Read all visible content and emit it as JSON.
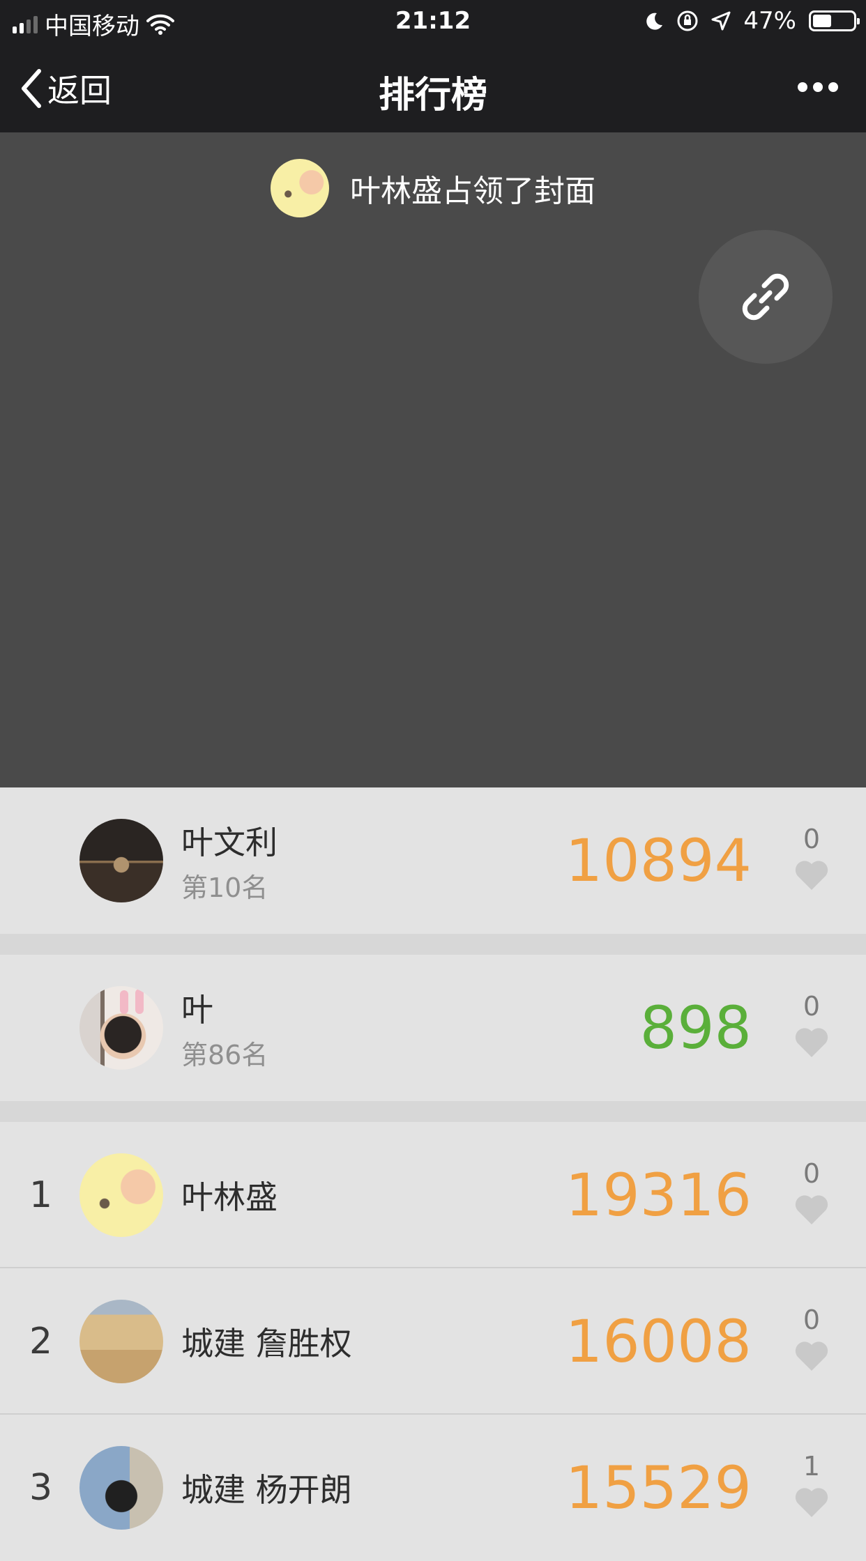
{
  "status_bar": {
    "carrier": "中国移动",
    "time": "21:12",
    "battery": "47%",
    "battery_level": 0.47
  },
  "nav": {
    "back_label": "返回",
    "title": "排行榜"
  },
  "cover": {
    "owner_text": "叶林盛占领了封面"
  },
  "my_rank": {
    "name": "叶文利",
    "rank": "第10名",
    "steps": "10894",
    "likes": "0"
  },
  "friend_rank": {
    "name": "叶",
    "rank": "第86名",
    "steps": "898",
    "likes": "0"
  },
  "ranking": [
    {
      "position": "1",
      "name": "叶林盛",
      "steps": "19316",
      "likes": "0"
    },
    {
      "position": "2",
      "name": "城建 詹胜权",
      "steps": "16008",
      "likes": "0"
    },
    {
      "position": "3",
      "name": "城建 杨开朗",
      "steps": "15529",
      "likes": "1"
    }
  ],
  "colors": {
    "steps_high": "#f0a043",
    "steps_low": "#5aaf3a",
    "nav_bg": "#1e1e20",
    "cover_bg": "#4a4a4a"
  },
  "icons": [
    "signal-icon",
    "wifi-icon",
    "moon-icon",
    "rotation-lock-icon",
    "location-icon",
    "battery-icon",
    "back-chevron-icon",
    "more-icon",
    "link-icon",
    "heart-icon"
  ]
}
